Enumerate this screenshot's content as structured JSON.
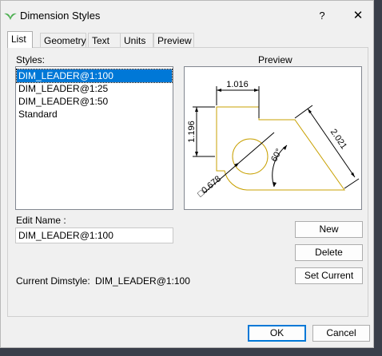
{
  "window": {
    "title": "Dimension Styles",
    "help_glyph": "?",
    "close_glyph": "✕"
  },
  "tabs": [
    "List",
    "Geometry",
    "Text",
    "Units",
    "Preview"
  ],
  "styles_label": "Styles:",
  "styles": [
    "DIM_LEADER@1:100",
    "DIM_LEADER@1:25",
    "DIM_LEADER@1:50",
    "Standard"
  ],
  "selected_style_index": 0,
  "preview": {
    "label": "Preview",
    "dim_top": "1.016",
    "dim_left": "1.196",
    "dim_right": "2.021",
    "dim_angle": "60°",
    "dim_diameter": "□0.678"
  },
  "edit_name_label": "Edit Name :",
  "edit_name_value": "DIM_LEADER@1:100",
  "current_dimstyle_label": "Current Dimstyle:",
  "current_dimstyle_value": "DIM_LEADER@1:100",
  "buttons": {
    "new": "New",
    "delete": "Delete",
    "set_current": "Set Current",
    "ok": "OK",
    "cancel": "Cancel"
  },
  "colors": {
    "selection": "#0078d7",
    "geometry": "#c8a000",
    "accent_border": "#0078d7"
  }
}
